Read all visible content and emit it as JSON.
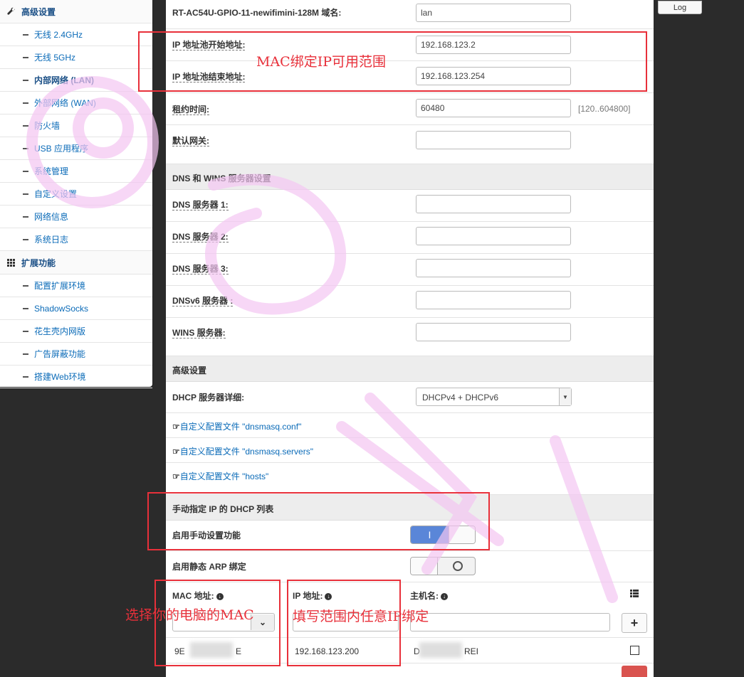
{
  "sidebar": {
    "sections": [
      {
        "title": "高级设置",
        "icon": "wrench-icon",
        "items": [
          "无线 2.4GHz",
          "无线 5GHz",
          "内部网络 (LAN)",
          "外部网络 (WAN)",
          "防火墙",
          "USB 应用程序",
          "系统管理",
          "自定义设置",
          "网络信息",
          "系统日志"
        ]
      },
      {
        "title": "扩展功能",
        "icon": "grid-icon",
        "items": [
          "配置扩展环境",
          "ShadowSocks",
          "花生壳内网版",
          "广告屏蔽功能",
          "搭建Web环境"
        ]
      }
    ],
    "active_item": "内部网络 (LAN)"
  },
  "log_button": "Log",
  "form": {
    "domain_label": "RT-AC54U-GPIO-11-newifimini-128M 域名:",
    "domain_value": "lan",
    "pool_start_label": "IP 地址池开始地址:",
    "pool_start_value": "192.168.123.2",
    "pool_end_label": "IP 地址池结束地址:",
    "pool_end_value": "192.168.123.254",
    "lease_label": "租约时间:",
    "lease_value": "60480",
    "lease_hint": "[120..604800]",
    "gateway_label": "默认网关:",
    "gateway_value": "",
    "dns_section": "DNS 和 WINS 服务器设置",
    "dns1_label": "DNS 服务器 1:",
    "dns2_label": "DNS 服务器 2:",
    "dns3_label": "DNS 服务器 3:",
    "dnsv6_label": "DNSv6 服务器 :",
    "wins_label": "WINS 服务器:",
    "advanced_section": "高级设置",
    "dhcp_detail_label": "DHCP 服务器详细:",
    "dhcp_detail_value": "DHCPv4 + DHCPv6",
    "link_dnsmasq_conf": "自定义配置文件 \"dnsmasq.conf\"",
    "link_dnsmasq_servers": "自定义配置文件 \"dnsmasq.servers\"",
    "link_hosts": "自定义配置文件 \"hosts\"",
    "manual_section": "手动指定 IP 的 DHCP 列表",
    "enable_manual_label": "启用手动设置功能",
    "enable_manual_state": "I",
    "static_arp_label": "启用静态 ARP 绑定",
    "table": {
      "col_mac": "MAC 地址:",
      "col_ip": "IP 地址:",
      "col_host": "主机名:",
      "row": {
        "mac_start": "9E",
        "mac_end": "E",
        "ip": "192.168.123.200",
        "host_start": "D",
        "host_end": "REI"
      }
    }
  },
  "annotations": {
    "mac_range": "MAC绑定IP可用范围",
    "select_mac": "选择你的电脑的MAC",
    "fill_ip": "填写范围内任意IP绑定"
  },
  "colors": {
    "accent": "#e8303a",
    "link": "#0b6bb8",
    "toggle_on": "#5a86d8",
    "watermark": "#f4c6f2"
  }
}
